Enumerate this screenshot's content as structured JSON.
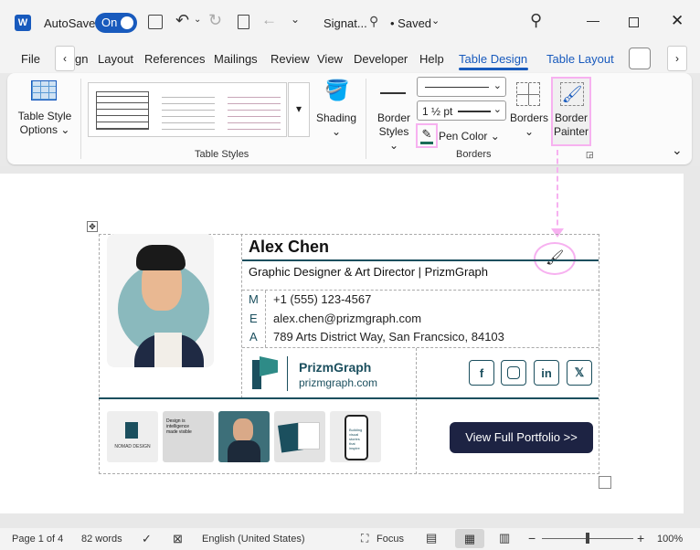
{
  "titlebar": {
    "autosave_label": "AutoSave",
    "toggle_label": "On",
    "doc_title": "Signat...",
    "saved_label": "• Saved"
  },
  "tabs": [
    "File",
    "gn",
    "Layout",
    "References",
    "Mailings",
    "Review",
    "View",
    "Developer",
    "Help",
    "Table Design",
    "Table Layout"
  ],
  "ribbon": {
    "table_style_options": "Table Style Options",
    "shading": "Shading",
    "table_styles_label": "Table Styles",
    "border_styles": "Border Styles",
    "weight": "1 ½ pt",
    "pen_color": "Pen Color",
    "borders": "Borders",
    "border_painter": "Border Painter",
    "borders_label": "Borders"
  },
  "signature": {
    "name": "Alex Chen",
    "title": "Graphic Designer & Art Director | PrizmGraph",
    "contacts": [
      {
        "k": "M",
        "v": "+1 (555) 123-4567"
      },
      {
        "k": "E",
        "v": "alex.chen@prizmgraph.com"
      },
      {
        "k": "A",
        "v": "789 Arts District Way, San Francsico, 84103"
      }
    ],
    "brand": "PrizmGraph",
    "brand_url": "prizmgraph.com",
    "social": [
      "f",
      "ig",
      "in",
      "x"
    ],
    "cta": "View Full Portfolio >>",
    "thumb_texts": [
      "NOMAD DESIGN",
      "Design is intelligence made visible",
      "",
      "",
      "Building visual stories that inspire"
    ]
  },
  "status": {
    "page": "Page 1 of 4",
    "words": "82 words",
    "language": "English (United States)",
    "focus": "Focus",
    "zoom": "100%"
  },
  "colors": {
    "accent": "#185abd",
    "teal": "#1b4f5e",
    "pink": "#f7b1f0",
    "navy": "#1d2343"
  }
}
